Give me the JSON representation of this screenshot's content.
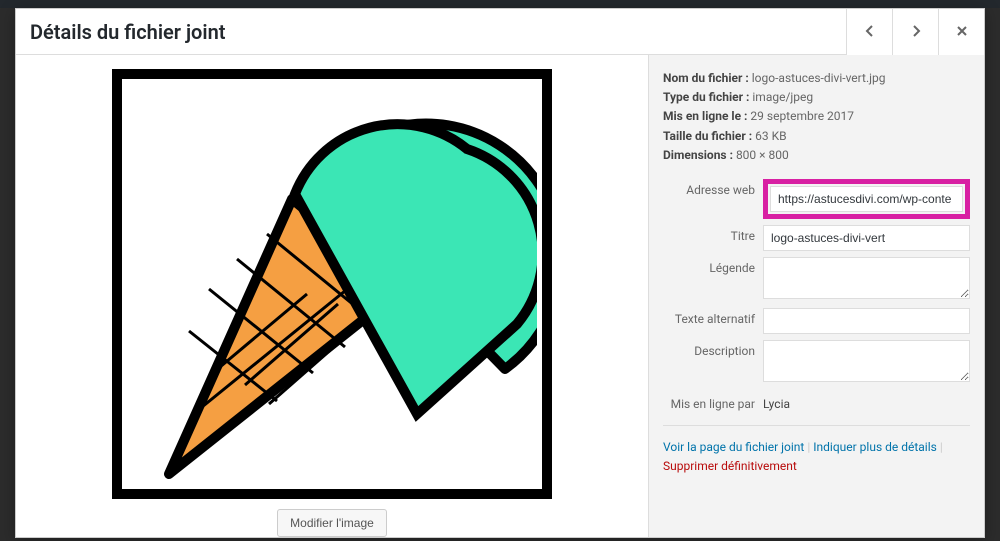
{
  "header": {
    "title": "Détails du fichier joint"
  },
  "meta": {
    "filename_label": "Nom du fichier :",
    "filename": "logo-astuces-divi-vert.jpg",
    "filetype_label": "Type du fichier :",
    "filetype": "image/jpeg",
    "uploaded_label": "Mis en ligne le :",
    "uploaded": "29 septembre 2017",
    "filesize_label": "Taille du fichier :",
    "filesize": "63 KB",
    "dimensions_label": "Dimensions :",
    "dimensions": "800 × 800"
  },
  "form": {
    "url_label": "Adresse web",
    "url_value": "https://astucesdivi.com/wp-conte",
    "title_label": "Titre",
    "title_value": "logo-astuces-divi-vert",
    "caption_label": "Légende",
    "caption_value": "",
    "alt_label": "Texte alternatif",
    "alt_value": "",
    "description_label": "Description",
    "description_value": "",
    "uploader_label": "Mis en ligne par",
    "uploader_name": "Lycia"
  },
  "buttons": {
    "edit_image": "Modifier l'image"
  },
  "links": {
    "view_attachment": "Voir la page du fichier joint",
    "more_details": "Indiquer plus de détails",
    "delete_permanently": "Supprimer définitivement"
  }
}
